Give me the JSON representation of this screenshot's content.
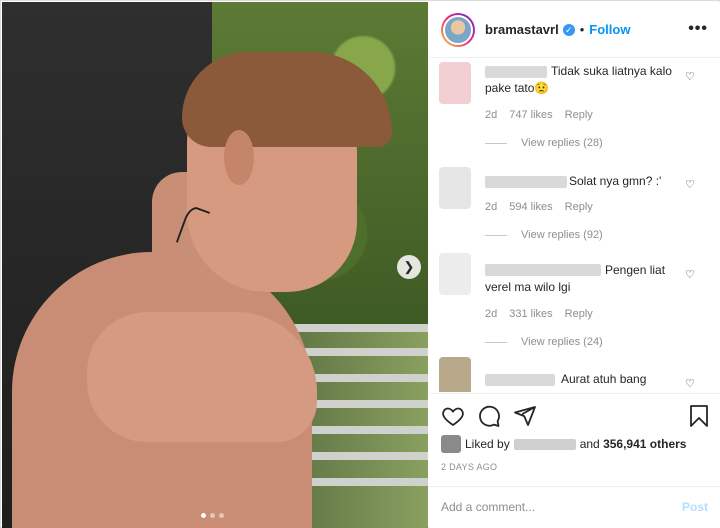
{
  "post": {
    "username": "bramastavrl",
    "follow_label": "Follow",
    "separator": "•",
    "more_label": "•••",
    "photo_dots": 3,
    "active_dot": 0
  },
  "comments": [
    {
      "text": "Tidak suka liatnya kalo pake tato😟",
      "likes": "747 likes",
      "time": "2d",
      "reply_label": "Reply",
      "view_replies": "View replies (28)",
      "avatar_color": "#f2cfd3"
    },
    {
      "text": "Solat nya gmn? :'",
      "likes": "594 likes",
      "time": "2d",
      "reply_label": "Reply",
      "view_replies": "View replies (92)",
      "avatar_color": "#e6e6e6"
    },
    {
      "text": "Pengen liat verel ma wilo lgi",
      "likes": "331 likes",
      "time": "2d",
      "reply_label": "Reply",
      "view_replies": "View replies (24)",
      "avatar_color": "#ececec"
    },
    {
      "text": "Aurat atuh bang",
      "avatar_color": "#b8a98a"
    }
  ],
  "likes_line": {
    "prefix": "Liked by",
    "middle": "and",
    "count": "356,941 others"
  },
  "date": "2 DAYS AGO",
  "add_comment": {
    "placeholder": "Add a comment...",
    "post_label": "Post"
  },
  "colors": {
    "accent": "#0095f6",
    "verified": "#3897f0",
    "post_disabled": "#b2dffc"
  }
}
